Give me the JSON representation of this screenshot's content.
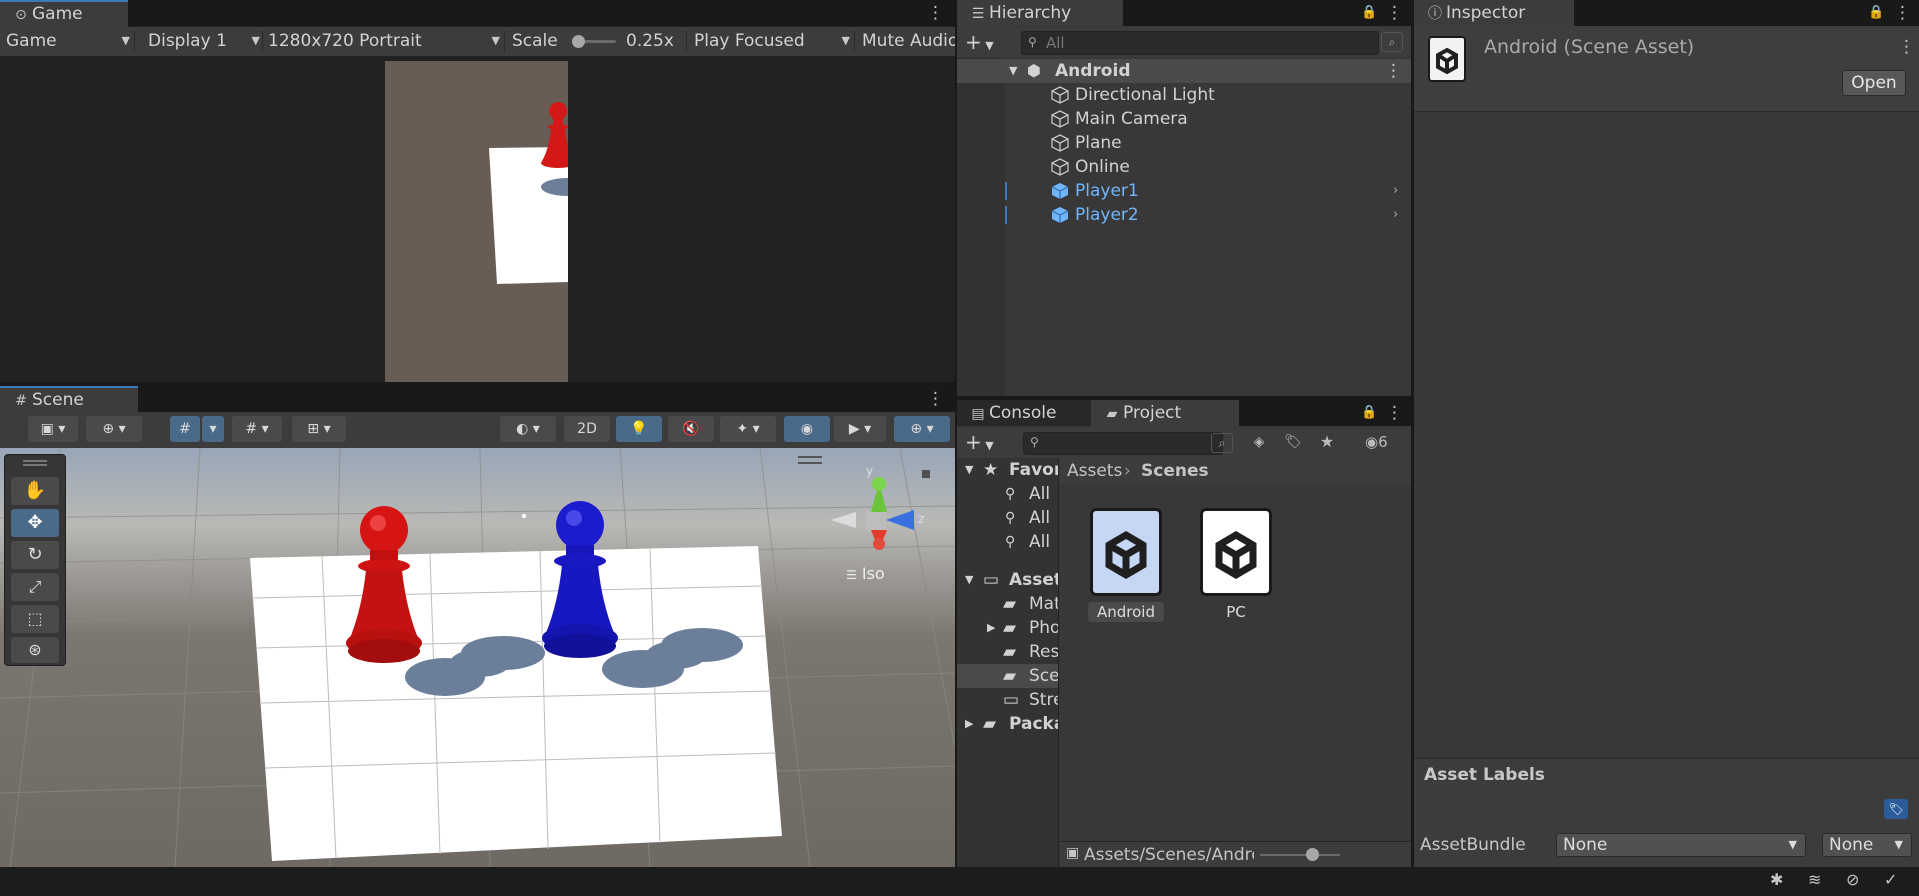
{
  "game": {
    "tab": "Game",
    "mode": "Game",
    "display": "Display 1",
    "resolution": "1280x720 Portrait",
    "scale_label": "Scale",
    "scale_value": "0.25x",
    "play_mode": "Play Focused",
    "mute": "Mute Audio"
  },
  "scene": {
    "tab": "Scene",
    "btn_2d": "2D",
    "iso_label": "Iso",
    "axis_y": "y",
    "axis_z": "z"
  },
  "hierarchy": {
    "tab": "Hierarchy",
    "search_placeholder": "All",
    "scene_name": "Android",
    "items": [
      {
        "label": "Directional Light",
        "prefab": false
      },
      {
        "label": "Main Camera",
        "prefab": false
      },
      {
        "label": "Plane",
        "prefab": false
      },
      {
        "label": "Online",
        "prefab": false
      },
      {
        "label": "Player1",
        "prefab": true
      },
      {
        "label": "Player2",
        "prefab": true
      }
    ]
  },
  "inspector": {
    "tab": "Inspector",
    "title": "Android (Scene Asset)",
    "open_button": "Open",
    "asset_labels": "Asset Labels",
    "assetbundle_label": "AssetBundle",
    "assetbundle_value": "None",
    "variant_value": "None"
  },
  "console": {
    "tab": "Console"
  },
  "project": {
    "tab": "Project",
    "hidden_count": "6",
    "favorites_label": "Favorites",
    "favorites": [
      "All",
      "All",
      "All"
    ],
    "assets_label": "Assets",
    "asset_folders": [
      "Materials",
      "Photon",
      "Resources",
      "Scenes",
      "StreamingAssets"
    ],
    "packages_label": "Packages",
    "breadcrumb": [
      "Assets",
      "Scenes"
    ],
    "files": [
      "Android",
      "PC"
    ],
    "footer_path": "Assets/Scenes/Android.unity"
  },
  "colors": {
    "accent": "#3a79bb",
    "prefab_blue": "#6fb6ff",
    "panel_bg": "#383838",
    "toolbar_bg": "#3c3c3c"
  }
}
